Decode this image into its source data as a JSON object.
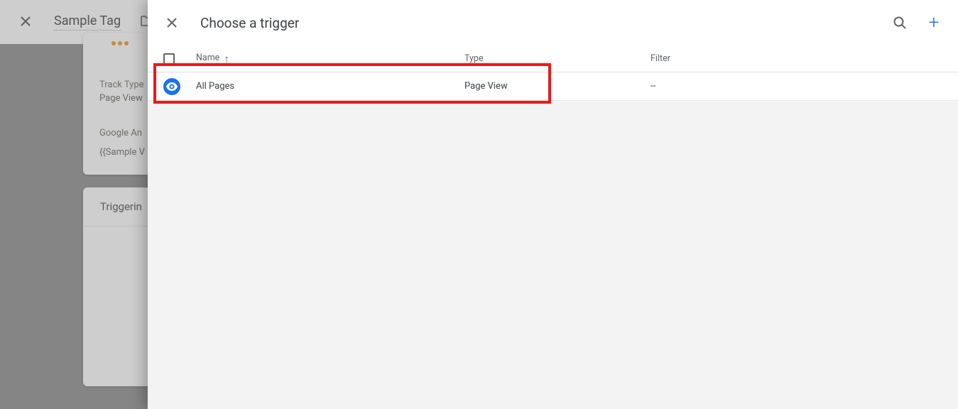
{
  "background": {
    "tag_title": "Sample Tag",
    "track_type_label": "Track Type",
    "track_type_value": "Page View",
    "settings_label": "Google An",
    "settings_value": "{{Sample V",
    "triggering_label": "Triggerin"
  },
  "modal": {
    "title": "Choose a trigger",
    "columns": {
      "name": "Name",
      "type": "Type",
      "filter": "Filter"
    },
    "rows": [
      {
        "name": "All Pages",
        "type": "Page View",
        "filter": "--"
      }
    ]
  }
}
